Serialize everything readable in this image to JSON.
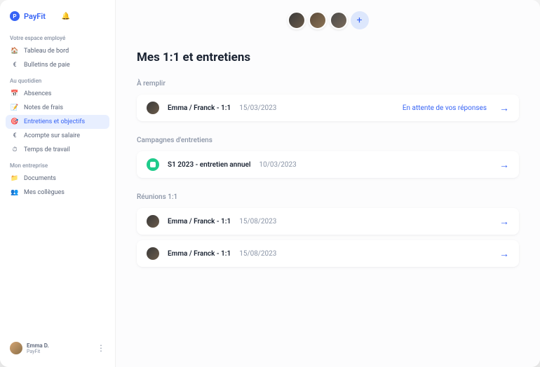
{
  "brand": "PayFit",
  "sidebar": {
    "sections": [
      {
        "label": "Votre espace employé",
        "items": [
          {
            "icon": "🏠",
            "label": "Tableau de bord"
          },
          {
            "icon": "€",
            "label": "Bulletins de paie"
          }
        ]
      },
      {
        "label": "Au quotidien",
        "items": [
          {
            "icon": "📅",
            "label": "Absences"
          },
          {
            "icon": "📝",
            "label": "Notes de frais"
          },
          {
            "icon": "🎯",
            "label": "Entretiens et objectifs",
            "active": true
          },
          {
            "icon": "€",
            "label": "Acompte sur salaire"
          },
          {
            "icon": "⏱",
            "label": "Temps de travail"
          }
        ]
      },
      {
        "label": "Mon entreprise",
        "items": [
          {
            "icon": "📁",
            "label": "Documents"
          },
          {
            "icon": "👥",
            "label": "Mes collègues"
          }
        ]
      }
    ],
    "user": {
      "name": "Emma D.",
      "sub": "PayFit"
    }
  },
  "main": {
    "title": "Mes 1:1 et entretiens",
    "groups": [
      {
        "label": "À remplir",
        "items": [
          {
            "avatar": "person",
            "title": "Emma / Franck - 1:1",
            "date": "15/03/2023",
            "status": "En attente de vos réponses"
          }
        ]
      },
      {
        "label": "Campagnes d'entretiens",
        "items": [
          {
            "avatar": "green",
            "title": "S1 2023 - entretien annuel",
            "date": "10/03/2023"
          }
        ]
      },
      {
        "label": "Réunions 1:1",
        "items": [
          {
            "avatar": "person",
            "title": "Emma / Franck - 1:1",
            "date": "15/08/2023"
          },
          {
            "avatar": "person",
            "title": "Emma / Franck - 1:1",
            "date": "15/08/2023"
          }
        ]
      }
    ]
  }
}
